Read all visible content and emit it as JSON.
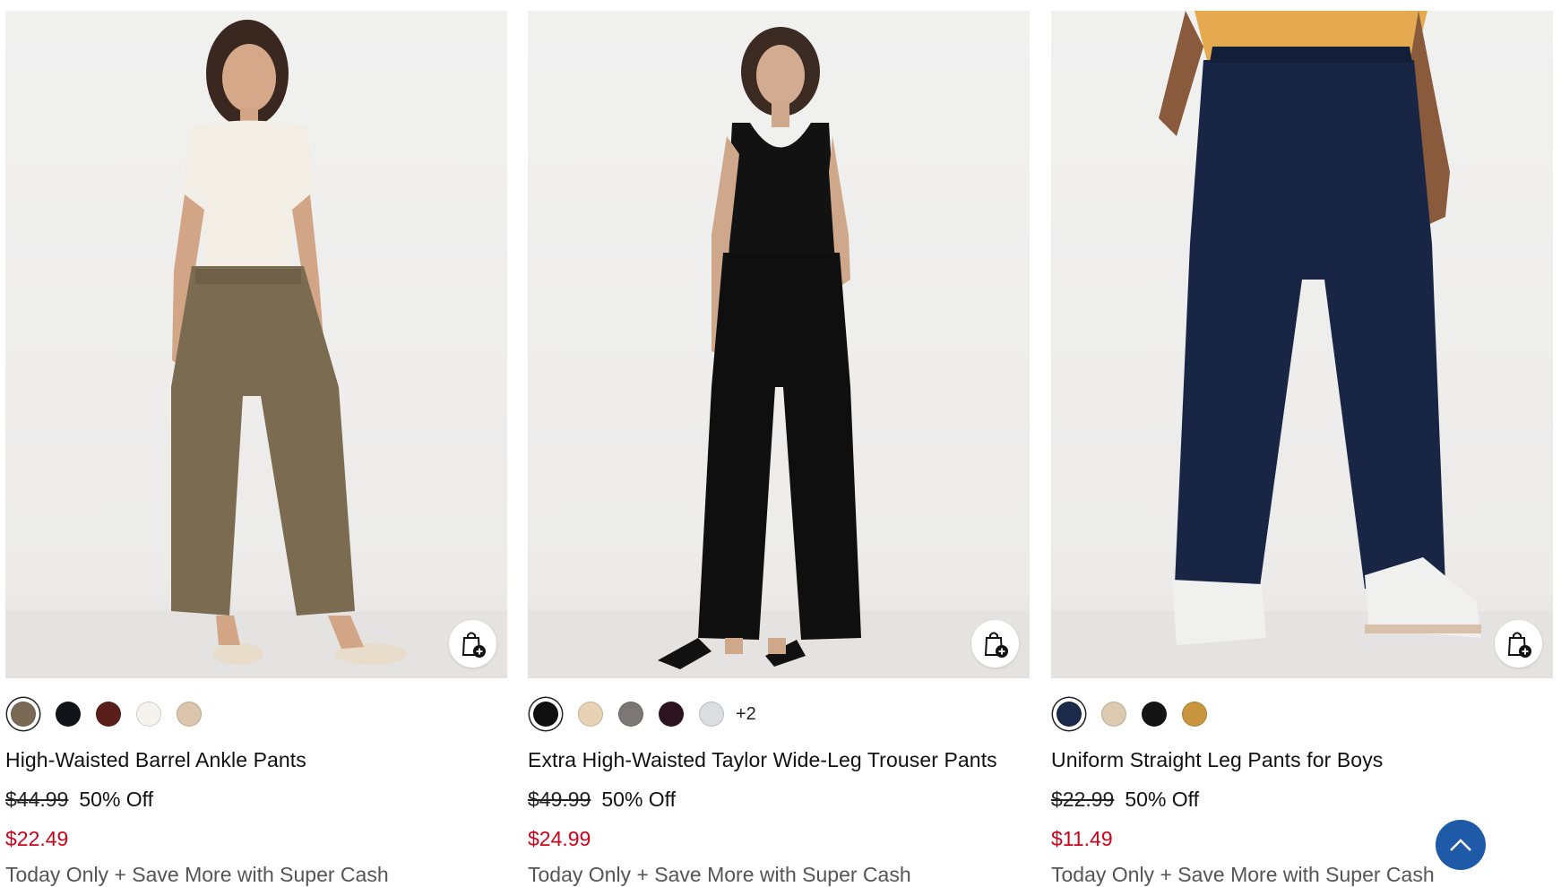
{
  "products": [
    {
      "name": "High-Waisted Barrel Ankle Pants",
      "original_price": "$44.99",
      "discount": "50% Off",
      "sale_price": "$22.49",
      "promo": "Today Only + Save More with Super Cash",
      "swatches": [
        "#7a6a55",
        "#111418",
        "#5a1f1a",
        "#f5f3ee",
        "#dcc5ad"
      ],
      "selected_swatch": 0,
      "more_colors": ""
    },
    {
      "name": "Extra High-Waisted Taylor Wide-Leg Trouser Pants",
      "original_price": "$49.99",
      "discount": "50% Off",
      "sale_price": "$24.99",
      "promo": "Today Only + Save More with Super Cash",
      "swatches": [
        "#101010",
        "#e7d2b6",
        "#7c7676",
        "#2b1420",
        "#dcdde0"
      ],
      "selected_swatch": 0,
      "more_colors": "+2"
    },
    {
      "name": "Uniform Straight Leg Pants for Boys",
      "original_price": "$22.99",
      "discount": "50% Off",
      "sale_price": "$11.49",
      "promo": "Today Only + Save More with Super Cash",
      "swatches": [
        "#1b2a48",
        "#dccab0",
        "#141414",
        "#c9963f"
      ],
      "selected_swatch": 0,
      "more_colors": ""
    }
  ],
  "icons": {
    "add_to_bag": "shopping-bag-plus-icon",
    "back_to_top": "chevron-up-icon"
  },
  "colors": {
    "sale_price": "#d0021b",
    "back_to_top": "#1e5aa8"
  }
}
